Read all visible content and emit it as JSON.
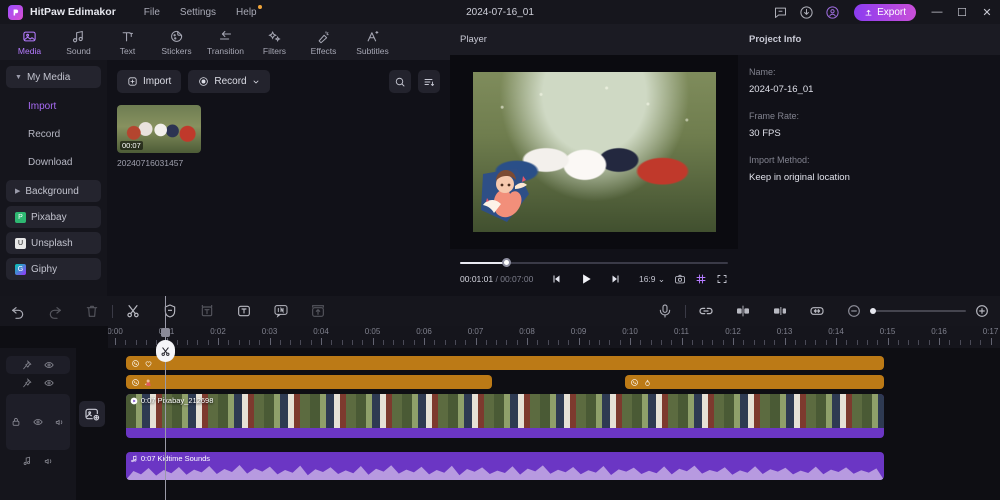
{
  "titlebar": {
    "app_name": "HitPaw Edimakor",
    "logo_icon": "hitpaw-logo-icon",
    "menus": [
      {
        "label": "File",
        "icon": "menu-file"
      },
      {
        "label": "Settings",
        "icon": "menu-settings"
      },
      {
        "label": "Help",
        "icon": "menu-help",
        "has_dot": true
      }
    ],
    "document_title": "2024-07-16_01",
    "right_icons": [
      "feedback-icon",
      "download-icon",
      "account-icon"
    ],
    "export_label": "Export",
    "export_icon": "upload-icon",
    "window_controls": [
      {
        "name": "minimize-button",
        "glyph": "—"
      },
      {
        "name": "maximize-button",
        "glyph": "☐"
      },
      {
        "name": "close-button",
        "glyph": "✕"
      }
    ],
    "accent_color": "#9b4dff",
    "export_gradient_from": "#8b3cf0",
    "export_gradient_to": "#c94fd8"
  },
  "tool_tabs": [
    {
      "label": "Media",
      "icon": "media-icon",
      "active": true
    },
    {
      "label": "Sound",
      "icon": "sound-icon",
      "active": false
    },
    {
      "label": "Text",
      "icon": "text-icon",
      "active": false
    },
    {
      "label": "Stickers",
      "icon": "stickers-icon",
      "active": false
    },
    {
      "label": "Transition",
      "icon": "transition-icon",
      "active": false
    },
    {
      "label": "Filters",
      "icon": "filters-icon",
      "active": false
    },
    {
      "label": "Effects",
      "icon": "effects-icon",
      "active": false
    },
    {
      "label": "Subtitles",
      "icon": "subtitles-icon",
      "active": false
    }
  ],
  "left_nav": {
    "my_media": {
      "label": "My Media",
      "expanded": true
    },
    "sub_items": [
      {
        "label": "Import",
        "active": true
      },
      {
        "label": "Record",
        "active": false
      },
      {
        "label": "Download",
        "active": false
      }
    ],
    "background": {
      "label": "Background",
      "expanded": false
    },
    "stock_sources": [
      {
        "label": "Pixabay",
        "icon": "pixabay-icon",
        "color": "#2eb872"
      },
      {
        "label": "Unsplash",
        "icon": "unsplash-icon",
        "color": "#e8e8e8"
      },
      {
        "label": "Giphy",
        "icon": "giphy-icon",
        "color": "#00ccb0"
      }
    ]
  },
  "media_panel": {
    "import_label": "Import",
    "import_icon": "plus-box-icon",
    "record_label": "Record",
    "record_icon": "record-dot-icon",
    "record_caret_icon": "chevron-down-icon",
    "search_icon": "search-icon",
    "sort_icon": "sort-list-icon",
    "items": [
      {
        "name": "20240716031457",
        "duration": "00:07"
      }
    ]
  },
  "player": {
    "title": "Player",
    "current_time": "00:01:01",
    "total_time": "00:07:00",
    "separator": "/",
    "progress_percent": 17,
    "transport": [
      {
        "name": "prev-frame-button",
        "icon": "step-backward-icon"
      },
      {
        "name": "play-button",
        "icon": "play-icon"
      },
      {
        "name": "next-frame-button",
        "icon": "step-forward-icon"
      }
    ],
    "aspect_ratio": "16:9",
    "aspect_caret_icon": "chevron-down-icon",
    "snapshot_icon": "camera-icon",
    "grid_icon": "grid-icon",
    "grid_active": true,
    "fullscreen_icon": "fullscreen-icon",
    "overlay_sticker": "cupid-sticker"
  },
  "project_info": {
    "title": "Project Info",
    "fields": [
      {
        "label": "Name:",
        "value": "2024-07-16_01"
      },
      {
        "label": "Frame Rate:",
        "value": "30 FPS"
      },
      {
        "label": "Import Method:",
        "value": "Keep in original location"
      }
    ]
  },
  "timeline": {
    "toolbar_left": [
      {
        "name": "undo-button",
        "icon": "undo-icon",
        "enabled": true
      },
      {
        "name": "redo-button",
        "icon": "redo-icon",
        "enabled": false
      },
      {
        "name": "delete-button",
        "icon": "trash-icon",
        "enabled": false
      },
      {
        "name": "split-button",
        "icon": "scissors-icon",
        "enabled": true
      },
      {
        "name": "mask-button",
        "icon": "shield-icon",
        "enabled": true
      },
      {
        "name": "crop-button",
        "icon": "crop-text-icon",
        "enabled": false
      },
      {
        "name": "text-button",
        "icon": "text-box-icon",
        "enabled": true
      },
      {
        "name": "ai-button",
        "icon": "ai-icon",
        "enabled": true
      },
      {
        "name": "export-frame-button",
        "icon": "export-frame-icon",
        "enabled": false
      }
    ],
    "toolbar_right": [
      {
        "name": "voiceover-button",
        "icon": "microphone-icon"
      },
      {
        "name": "link-clips-button",
        "icon": "link-icon"
      },
      {
        "name": "split-both-button",
        "icon": "split-both-icon"
      },
      {
        "name": "split-side-button",
        "icon": "split-side-icon"
      },
      {
        "name": "fit-timeline-button",
        "icon": "fit-width-icon"
      },
      {
        "name": "zoom-out-button",
        "icon": "minus-circle-icon"
      },
      {
        "name": "zoom-in-button",
        "icon": "plus-circle-icon"
      }
    ],
    "zoom_value_percent": 0,
    "ruler_labels": [
      "0:00",
      "0:01",
      "0:02",
      "0:03",
      "0:04",
      "0:05",
      "0:06",
      "0:07",
      "0:08",
      "0:09",
      "0:10",
      "0:11",
      "0:12",
      "0:13",
      "0:14",
      "0:15",
      "0:16",
      "0:17"
    ],
    "playhead_time": "0:01",
    "playhead_cut_icon": "scissors-icon",
    "add_media_icon": "add-media-icon",
    "track_controls": [
      {
        "name": "sticker-track-1",
        "icons": [
          "pin-icon",
          "eye-icon"
        ],
        "filled": true
      },
      {
        "name": "sticker-track-2",
        "icons": [
          "pin-icon",
          "eye-icon"
        ],
        "filled": false
      },
      {
        "name": "video-track",
        "icons": [
          "lock-icon",
          "eye-icon",
          "mute-icon"
        ],
        "filled": true
      },
      {
        "name": "audio-track",
        "icons": [
          "music-icon",
          "mute-icon"
        ],
        "filled": false
      }
    ],
    "clips": [
      {
        "track": "sticker-1",
        "label": "",
        "icon": "sticker-heart-icon",
        "start_pct": 2,
        "width_pct": 85,
        "color": "#bc7a16"
      },
      {
        "track": "sticker-2a",
        "label": "",
        "icon": "sticker-cupid-icon",
        "start_pct": 2,
        "width_pct": 41,
        "color": "#bc7a16"
      },
      {
        "track": "sticker-2b",
        "label": "",
        "icon": "sticker-ring-icon",
        "start_pct": 58,
        "width_pct": 29,
        "color": "#bc7a16"
      },
      {
        "track": "video",
        "label": "0:07 Pixabay_212698",
        "icon": "video-clip-icon",
        "start_pct": 2,
        "width_pct": 85,
        "color": "#6b36c4"
      },
      {
        "track": "audio",
        "label": "0:07 Kidtime Sounds",
        "icon": "audio-clip-icon",
        "start_pct": 2,
        "width_pct": 85,
        "color": "#6b36c4"
      }
    ]
  }
}
